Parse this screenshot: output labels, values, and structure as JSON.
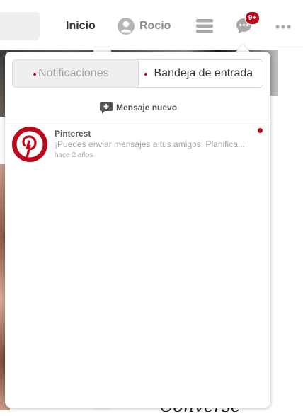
{
  "header": {
    "nav_home": "Inicio",
    "profile_name": "Rocio",
    "messages_badge": "9+",
    "icons": [
      "user-avatar-icon",
      "menu-icon",
      "speech-bubble-icon",
      "more-icon"
    ]
  },
  "popover": {
    "tabs": {
      "notifications": "Notificaciones",
      "inbox": "Bandeja de entrada"
    },
    "new_message": "Mensaje nuevo",
    "conversations": [
      {
        "name": "Pinterest",
        "preview": "¡Puedes enviar mensajes a tus amigos! Planifica...",
        "time": "hace 2 años",
        "unread": true,
        "avatar": "pinterest-logo-icon"
      }
    ]
  },
  "background": {
    "script_word": "Converse"
  },
  "colors": {
    "brand": "#bd081c",
    "muted_text": "#a5a5a5",
    "text": "#333333"
  }
}
